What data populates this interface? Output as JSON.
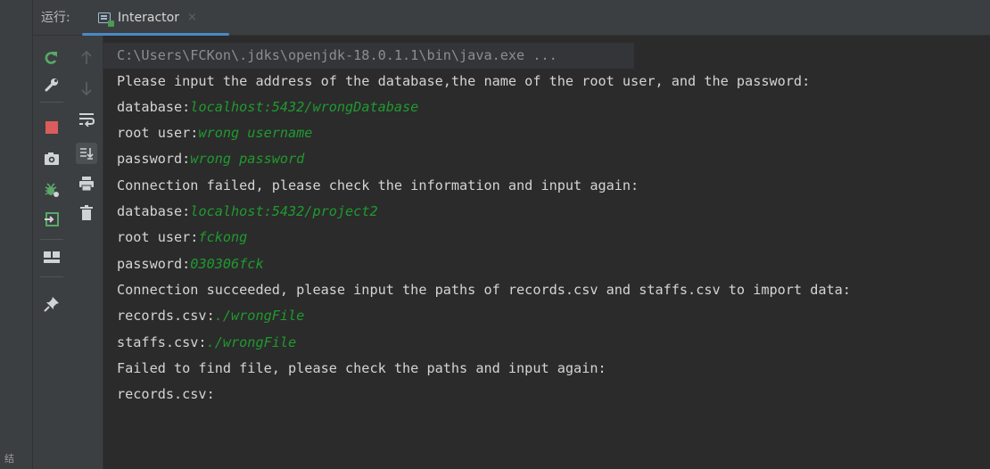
{
  "sidebar": {
    "edge_label": "结"
  },
  "header": {
    "label": "运行:",
    "tab": {
      "title": "Interactor",
      "close_glyph": "×",
      "icon": "console-window-icon"
    }
  },
  "toolbar_primary": [
    {
      "name": "rerun-icon",
      "color": "#59a869"
    },
    {
      "name": "wrench-icon",
      "color": "#cfd3d6"
    },
    {
      "name": "stop-icon",
      "color": "#db5c5c"
    },
    {
      "name": "camera-icon",
      "color": "#cfd3d6"
    },
    {
      "name": "debug-bug-icon",
      "color": "#59a869"
    },
    {
      "name": "exit-icon",
      "color": "#59a869"
    },
    {
      "name": "layout-icon",
      "color": "#cfd3d6"
    },
    {
      "name": "pin-icon",
      "color": "#cfd3d6"
    }
  ],
  "toolbar_secondary": [
    {
      "name": "up-arrow-icon",
      "color": "#5a5d5f"
    },
    {
      "name": "down-arrow-icon",
      "color": "#5a5d5f"
    },
    {
      "name": "soft-wrap-icon",
      "color": "#cfd3d6"
    },
    {
      "name": "scroll-to-end-icon",
      "color": "#cfd3d6"
    },
    {
      "name": "print-icon",
      "color": "#cfd3d6"
    },
    {
      "name": "trash-icon",
      "color": "#cfd3d6"
    }
  ],
  "console": {
    "command": "C:\\Users\\FCKon\\.jdks\\openjdk-18.0.1.1\\bin\\java.exe ...",
    "lines": [
      {
        "prompt": "Please input the address of the database,the name of the root user, and the password:",
        "input": ""
      },
      {
        "prompt": "database:",
        "input": "localhost:5432/wrongDatabase"
      },
      {
        "prompt": "root user:",
        "input": "wrong username"
      },
      {
        "prompt": "password:",
        "input": "wrong password"
      },
      {
        "prompt": "Connection failed, please check the information and input again:",
        "input": ""
      },
      {
        "prompt": "database:",
        "input": "localhost:5432/project2"
      },
      {
        "prompt": "root user:",
        "input": "fckong"
      },
      {
        "prompt": "password:",
        "input": "030306fck"
      },
      {
        "prompt": "Connection succeeded, please input the paths of records.csv and staffs.csv to import data:",
        "input": ""
      },
      {
        "prompt": "records.csv:",
        "input": "./wrongFile"
      },
      {
        "prompt": "staffs.csv:",
        "input": "./wrongFile"
      },
      {
        "prompt": "Failed to find file, please check the paths and input again:",
        "input": ""
      },
      {
        "prompt": "records.csv:",
        "input": ""
      }
    ]
  }
}
